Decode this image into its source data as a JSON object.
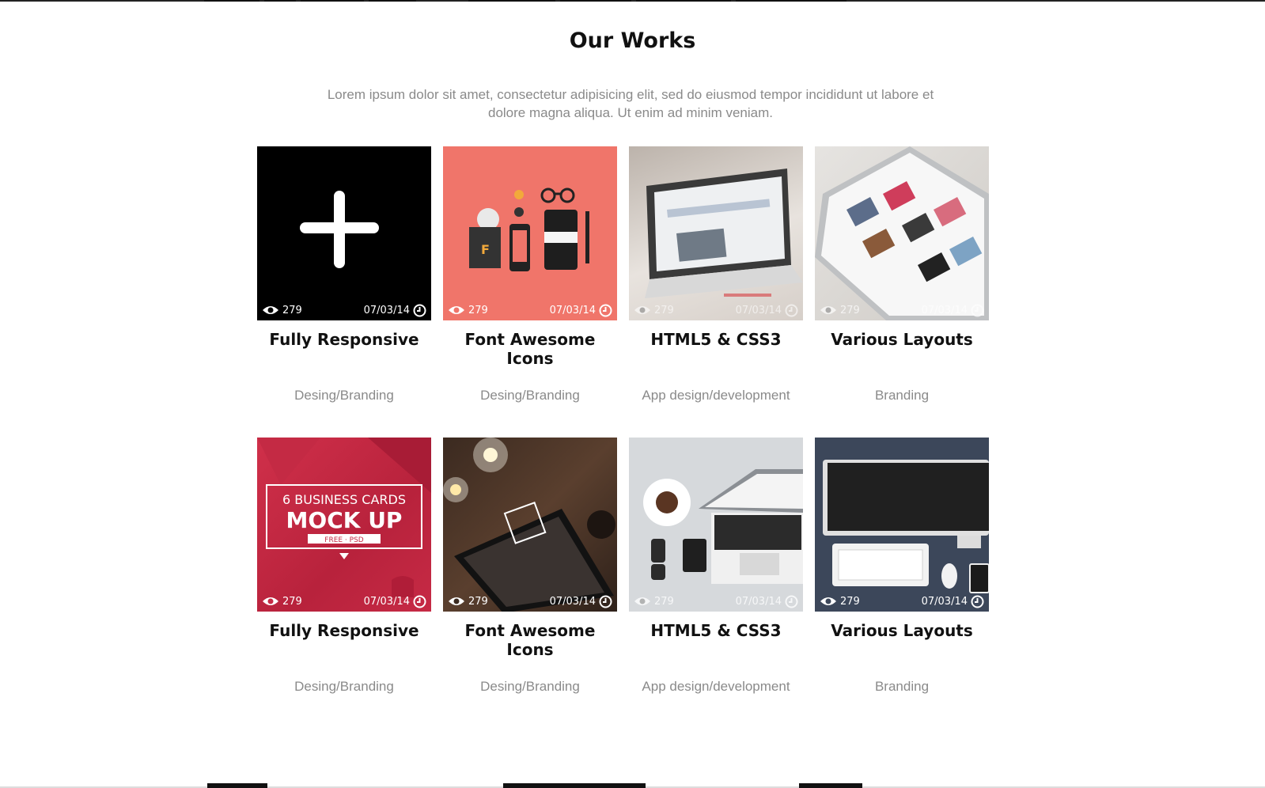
{
  "section": {
    "title": "Our Works",
    "intro": "Lorem ipsum dolor sit amet, consectetur adipisicing elit, sed do eiusmod tempor incididunt ut labore et dolore magna aliqua. Ut enim ad minim veniam."
  },
  "works": [
    {
      "title": "Fully Responsive",
      "category": "Desing/Branding",
      "views": "279",
      "date": "07/03/14"
    },
    {
      "title": "Font Awesome Icons",
      "category": "Desing/Branding",
      "views": "279",
      "date": "07/03/14"
    },
    {
      "title": "HTML5 & CSS3",
      "category": "App design/development",
      "views": "279",
      "date": "07/03/14"
    },
    {
      "title": "Various Layouts",
      "category": "Branding",
      "views": "279",
      "date": "07/03/14"
    },
    {
      "title": "Fully Responsive",
      "category": "Desing/Branding",
      "views": "279",
      "date": "07/03/14"
    },
    {
      "title": "Font Awesome Icons",
      "category": "Desing/Branding",
      "views": "279",
      "date": "07/03/14"
    },
    {
      "title": "HTML5 & CSS3",
      "category": "App design/development",
      "views": "279",
      "date": "07/03/14"
    },
    {
      "title": "Various Layouts",
      "category": "Branding",
      "views": "279",
      "date": "07/03/14"
    }
  ],
  "mockup_text": {
    "line1": "6 BUSINESS CARDS",
    "line2": "MOCK UP",
    "line3": "FREE · PSD"
  }
}
